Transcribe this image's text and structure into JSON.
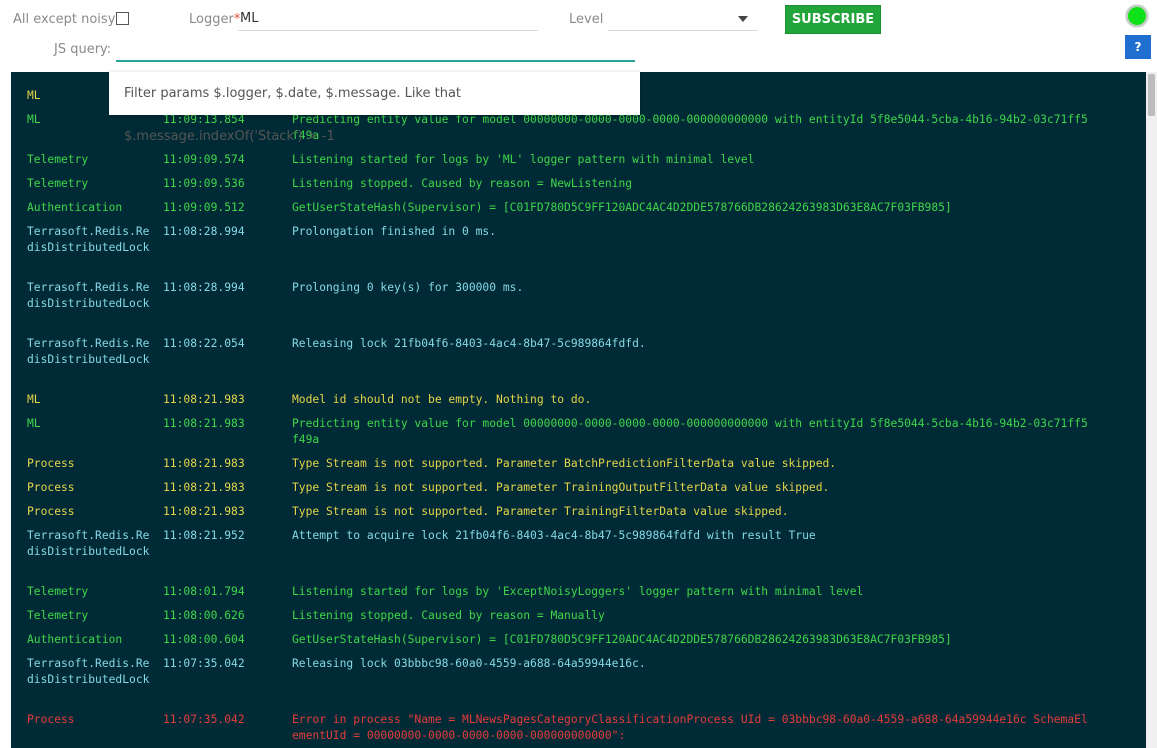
{
  "toolbar": {
    "noisy_label": "All except noisy",
    "logger_label": "Logger",
    "logger_required": "*",
    "logger_value": "ML",
    "level_label": "Level",
    "level_value": "",
    "subscribe_label": "SUBSCRIBE",
    "help_label": "?",
    "status_color": "#10e21a",
    "js_query_label": "JS query:",
    "js_query_value": ""
  },
  "tooltip": {
    "text": "Filter params $.logger, $.date, $.message. Like that $.message.indexOf('Stack') > -1"
  },
  "log": {
    "rows": [
      {
        "logger": "ML",
        "date": "",
        "message": "",
        "level": "yellow"
      },
      {
        "logger": "ML",
        "date": "11:09:13.854",
        "message": "Predicting entity value for model 00000000-0000-0000-0000-000000000000 with entityId 5f8e5044-5cba-4b16-94b2-03c71ff5f49a",
        "level": "green"
      },
      {
        "logger": "Telemetry",
        "date": "11:09:09.574",
        "message": "Listening started for logs by 'ML' logger pattern with minimal level",
        "level": "green"
      },
      {
        "logger": "Telemetry",
        "date": "11:09:09.536",
        "message": "Listening stopped. Caused by reason = NewListening",
        "level": "green"
      },
      {
        "logger": "Authentication",
        "date": "11:09:09.512",
        "message": "GetUserStateHash(Supervisor) = [C01FD780D5C9FF120ADC4AC4D2DDE578766DB28624263983D63E8AC7F03FB985]",
        "level": "green"
      },
      {
        "logger": "Terrasoft.Redis.RedisDistributedLock",
        "date": "11:08:28.994",
        "message": "Prolongation finished in 0 ms.",
        "level": "cyan"
      },
      {
        "logger": "Terrasoft.Redis.RedisDistributedLock",
        "date": "11:08:28.994",
        "message": "Prolonging 0 key(s) for 300000 ms.",
        "level": "cyan"
      },
      {
        "logger": "Terrasoft.Redis.RedisDistributedLock",
        "date": "11:08:22.054",
        "message": "Releasing lock 21fb04f6-8403-4ac4-8b47-5c989864fdfd.",
        "level": "cyan"
      },
      {
        "logger": "ML",
        "date": "11:08:21.983",
        "message": "Model id should not be empty. Nothing to do.",
        "level": "yellow"
      },
      {
        "logger": "ML",
        "date": "11:08:21.983",
        "message": "Predicting entity value for model 00000000-0000-0000-0000-000000000000 with entityId 5f8e5044-5cba-4b16-94b2-03c71ff5f49a",
        "level": "green"
      },
      {
        "logger": "Process",
        "date": "11:08:21.983",
        "message": "Type Stream is not supported. Parameter BatchPredictionFilterData value skipped.",
        "level": "yellow"
      },
      {
        "logger": "Process",
        "date": "11:08:21.983",
        "message": "Type Stream is not supported. Parameter TrainingOutputFilterData value skipped.",
        "level": "yellow"
      },
      {
        "logger": "Process",
        "date": "11:08:21.983",
        "message": "Type Stream is not supported. Parameter TrainingFilterData value skipped.",
        "level": "yellow"
      },
      {
        "logger": "Terrasoft.Redis.RedisDistributedLock",
        "date": "11:08:21.952",
        "message": "Attempt to acquire lock 21fb04f6-8403-4ac4-8b47-5c989864fdfd with result True",
        "level": "cyan"
      },
      {
        "logger": "Telemetry",
        "date": "11:08:01.794",
        "message": "Listening started for logs by 'ExceptNoisyLoggers' logger pattern with minimal level",
        "level": "green"
      },
      {
        "logger": "Telemetry",
        "date": "11:08:00.626",
        "message": "Listening stopped. Caused by reason = Manually",
        "level": "green"
      },
      {
        "logger": "Authentication",
        "date": "11:08:00.604",
        "message": "GetUserStateHash(Supervisor) = [C01FD780D5C9FF120ADC4AC4D2DDE578766DB28624263983D63E8AC7F03FB985]",
        "level": "green"
      },
      {
        "logger": "Terrasoft.Redis.RedisDistributedLock",
        "date": "11:07:35.042",
        "message": "Releasing lock 03bbbc98-60a0-4559-a688-64a59944e16c.",
        "level": "cyan"
      },
      {
        "logger": "Process",
        "date": "11:07:35.042",
        "message": "Error in process \"Name = MLNewsPagesCategoryClassificationProcess UId = 03bbbc98-60a0-4559-a688-64a59944e16c SchemaElementUId = 00000000-0000-0000-0000-000000000000\":",
        "level": "red"
      }
    ]
  }
}
